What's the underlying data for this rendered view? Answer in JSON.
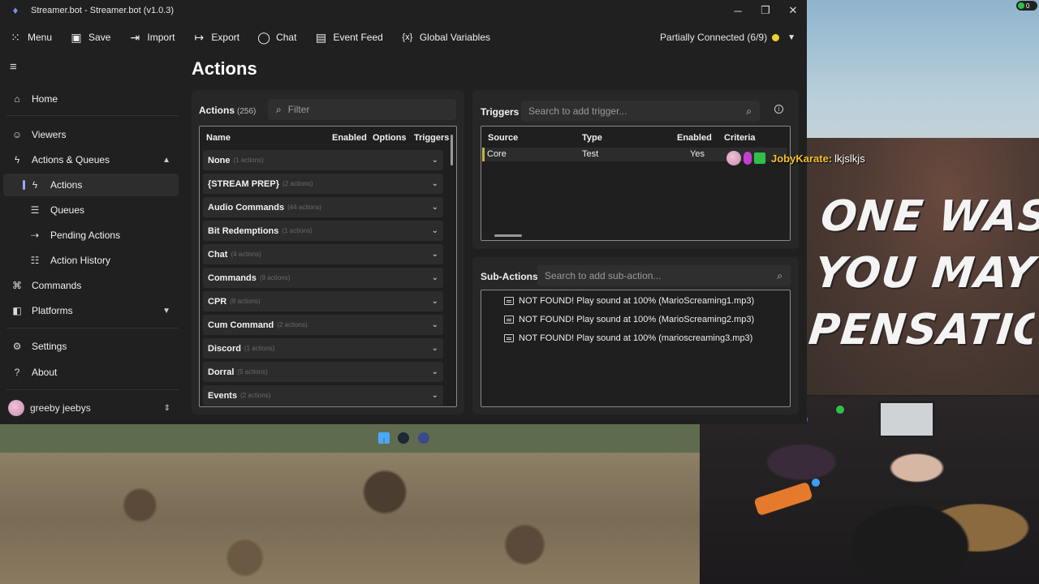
{
  "window": {
    "title": "Streamer.bot - Streamer.bot (v1.0.3)",
    "controls": {
      "minimize": "─",
      "maximize": "❐",
      "close": "✕"
    }
  },
  "toolbar": {
    "menu": "Menu",
    "save": "Save",
    "import": "Import",
    "export": "Export",
    "chat": "Chat",
    "event_feed": "Event Feed",
    "global_variables": "Global Variables",
    "connection_status": "Partially Connected (6/9)"
  },
  "sidebar": {
    "home": "Home",
    "viewers": "Viewers",
    "actions_queues": "Actions & Queues",
    "actions": "Actions",
    "queues": "Queues",
    "pending_actions": "Pending Actions",
    "action_history": "Action History",
    "commands": "Commands",
    "platforms": "Platforms",
    "settings": "Settings",
    "about": "About",
    "user": "greeby jeebys"
  },
  "page": {
    "title": "Actions"
  },
  "actions_panel": {
    "label": "Actions",
    "count": "(256)",
    "filter_placeholder": "Filter",
    "columns": {
      "name": "Name",
      "enabled": "Enabled",
      "options": "Options",
      "triggers": "Triggers"
    },
    "groups": [
      {
        "name": "None",
        "count": "(1 actions)"
      },
      {
        "name": "{STREAM PREP}",
        "count": "(2 actions)"
      },
      {
        "name": "Audio Commands",
        "count": "(44 actions)"
      },
      {
        "name": "Bit Redemptions",
        "count": "(1 actions)"
      },
      {
        "name": "Chat",
        "count": "(4 actions)"
      },
      {
        "name": "Commands",
        "count": "(9 actions)"
      },
      {
        "name": "CPR",
        "count": "(8 actions)"
      },
      {
        "name": "Cum Command",
        "count": "(2 actions)"
      },
      {
        "name": "Discord",
        "count": "(1 actions)"
      },
      {
        "name": "Dorral",
        "count": "(5 actions)"
      },
      {
        "name": "Events",
        "count": "(2 actions)"
      }
    ]
  },
  "triggers_panel": {
    "label": "Triggers",
    "search_placeholder": "Search to add trigger...",
    "columns": {
      "source": "Source",
      "type": "Type",
      "enabled": "Enabled",
      "criteria": "Criteria"
    },
    "rows": [
      {
        "source": "Core",
        "type": "Test",
        "enabled": "Yes",
        "criteria": ""
      }
    ]
  },
  "subactions_panel": {
    "label": "Sub-Actions",
    "search_placeholder": "Search to add sub-action...",
    "items": [
      "NOT FOUND! Play sound at 100% (MarioScreaming1.mp3)",
      "NOT FOUND! Play sound at 100% (MarioScreaming2.mp3)",
      "NOT FOUND! Play sound at 100% (marioscreaming3.mp3)"
    ]
  },
  "stream_overlay": {
    "chat_user": "JobyKarate:",
    "chat_message": "lkjslkjs",
    "scene_text": [
      "ONE WAS",
      "YOU MAY",
      "PENSATION"
    ],
    "corner_count": "0"
  },
  "colors": {
    "accent": "#9aa8ff",
    "connection_dot": "#f0d12a",
    "chat_user": "#f3c02b"
  }
}
